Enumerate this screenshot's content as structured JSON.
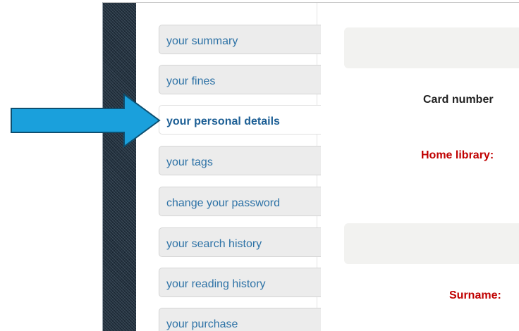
{
  "sidebar": {
    "items": [
      {
        "label": "your summary"
      },
      {
        "label": "your fines"
      },
      {
        "label": "your personal details",
        "active": true
      },
      {
        "label": "your tags"
      },
      {
        "label": "change your password"
      },
      {
        "label": "your search history"
      },
      {
        "label": "your reading history"
      },
      {
        "label": "your purchase"
      }
    ]
  },
  "main": {
    "fields": {
      "card_number": "Card number",
      "home_library": "Home library:",
      "surname": "Surname:"
    }
  },
  "colors": {
    "link": "#2d72a6",
    "required_label": "#c00000",
    "label": "#222222",
    "arrow_fill": "#1aa0dc",
    "arrow_stroke": "#0e4f70"
  },
  "annotation": {
    "icon": "arrow-right-icon"
  }
}
